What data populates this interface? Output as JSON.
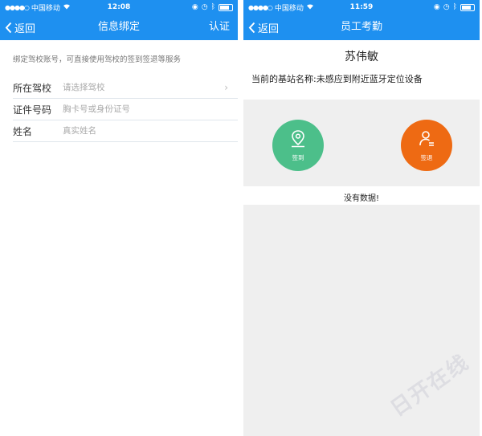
{
  "left_screen": {
    "status": {
      "carrier": "中国移动",
      "time": "12:08"
    },
    "nav": {
      "back_label": "返回",
      "title": "信息绑定",
      "action_label": "认证"
    },
    "hint": "绑定驾校账号，可直接使用驾校的签到签退等服务",
    "form": {
      "school_label": "所在驾校",
      "school_placeholder": "请选择驾校",
      "id_label": "证件号码",
      "id_placeholder": "胸卡号或身份证号",
      "name_label": "姓名",
      "name_placeholder": "真实姓名"
    }
  },
  "right_screen": {
    "status": {
      "carrier": "中国移动",
      "time": "11:59"
    },
    "nav": {
      "back_label": "返回",
      "title": "员工考勤"
    },
    "person_name": "苏伟敏",
    "station_text": "当前的基站名称:未感应到附近蓝牙定位设备",
    "checkin_label": "签到",
    "checkout_label": "签退",
    "empty_text": "没有数据!"
  },
  "watermark": "日开在线",
  "colors": {
    "header_blue": "#1e90f0",
    "checkin_green": "#4cbf8a",
    "checkout_orange": "#ee6a13",
    "panel_gray": "#efefef"
  }
}
